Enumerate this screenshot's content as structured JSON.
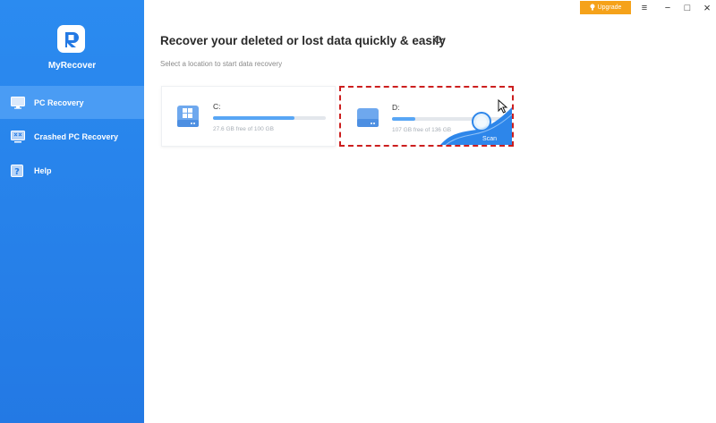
{
  "app": {
    "name": "MyRecover"
  },
  "sidebar": {
    "items": [
      {
        "label": "PC Recovery",
        "icon": "monitor-icon",
        "active": true
      },
      {
        "label": "Crashed PC Recovery",
        "icon": "crashed-pc-icon",
        "active": false
      },
      {
        "label": "Help",
        "icon": "help-icon",
        "active": false
      }
    ]
  },
  "titlebar": {
    "upgrade_label": "Upgrade",
    "menu_glyph": "≡",
    "minimize_glyph": "−",
    "maximize_glyph": "□",
    "close_glyph": "×"
  },
  "main": {
    "title": "Recover your deleted or lost data quickly & easily",
    "refresh_glyph": "⟳",
    "subtitle": "Select a location to start data recovery"
  },
  "drives": [
    {
      "name": "C:",
      "usage_text": "27.6 GB free of 100 GB",
      "used_fraction": 0.72,
      "icon": "windows-drive-icon"
    },
    {
      "name": "D:",
      "usage_text": "107 GB free of 136 GB",
      "used_fraction": 0.21,
      "icon": "drive-icon",
      "scan_label": "Scan"
    }
  ],
  "colors": {
    "sidebar": "#2379e4",
    "active_item": "#4a9cf4",
    "upgrade": "#f5a21a",
    "progress": "#58a6f5",
    "selection_border": "#cc1f1f"
  }
}
